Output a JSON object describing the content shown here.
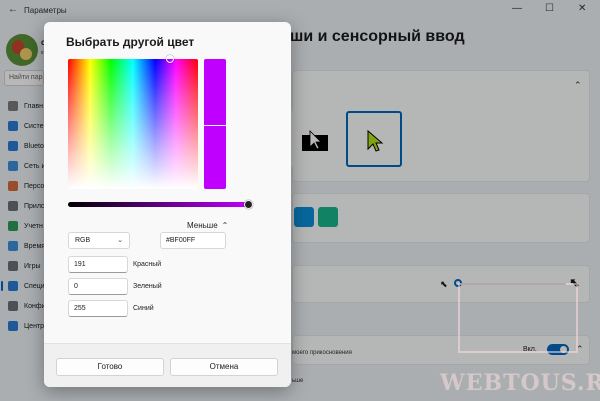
{
  "window": {
    "title": "Параметры",
    "user_name": "с",
    "user_sub": "в"
  },
  "search": {
    "placeholder": "Найти парам"
  },
  "sidebar": {
    "items": [
      {
        "label": "Главн",
        "icon": "home-icon",
        "color": "#7a7a7a"
      },
      {
        "label": "Систе",
        "icon": "monitor-icon",
        "color": "#2b7bd3"
      },
      {
        "label": "Blueto",
        "icon": "bluetooth-icon",
        "color": "#2b7bd3"
      },
      {
        "label": "Сеть и",
        "icon": "wifi-icon",
        "color": "#3a8fd8"
      },
      {
        "label": "Персо",
        "icon": "brush-icon",
        "color": "#d46c3a"
      },
      {
        "label": "Прилс",
        "icon": "apps-icon",
        "color": "#6b6f75"
      },
      {
        "label": "Учетн",
        "icon": "person-icon",
        "color": "#2f9a5a"
      },
      {
        "label": "Время",
        "icon": "globe-icon",
        "color": "#3a8fd8"
      },
      {
        "label": "Игры",
        "icon": "gamepad-icon",
        "color": "#6b6f75"
      },
      {
        "label": "Специ",
        "icon": "accessibility-icon",
        "color": "#2b7bd3",
        "active": true
      },
      {
        "label": "Конфи",
        "icon": "shield-icon",
        "color": "#6b6f75"
      },
      {
        "label": "Центр",
        "icon": "sync-icon",
        "color": "#2b7bd3"
      }
    ]
  },
  "page": {
    "title": "ши и сенсорный ввод",
    "touch_text": "моего прикосновения",
    "bottom_text": "ьше",
    "toggle_label": "Вкл."
  },
  "dialog": {
    "title": "Выбрать другой цвет",
    "less_label": "Меньше",
    "mode": "RGB",
    "hex": "#BF00FF",
    "red_value": "191",
    "red_label": "Красный",
    "green_value": "0",
    "green_label": "Зеленый",
    "blue_value": "255",
    "blue_label": "Синий",
    "ok_label": "Готово",
    "cancel_label": "Отмена",
    "selected_color": "#bf00ff"
  },
  "swatches": [
    "#0a8fd9",
    "#18b58a"
  ],
  "watermark": "WEBTOUS.RU"
}
